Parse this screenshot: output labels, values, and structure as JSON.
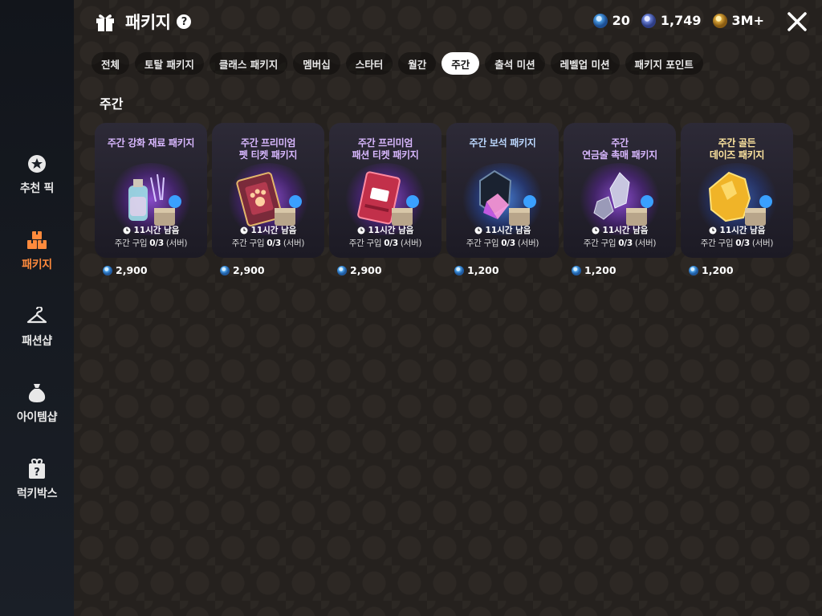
{
  "header": {
    "title": "패키지",
    "help": "?",
    "currencies": [
      {
        "name": "gem-icon",
        "value": "20"
      },
      {
        "name": "diamond-icon",
        "value": "1,749"
      },
      {
        "name": "gold-coin-icon",
        "value": "3M+"
      }
    ]
  },
  "sidebar": {
    "items": [
      {
        "label": "추천 픽",
        "icon": "star-badge-icon"
      },
      {
        "label": "패키지",
        "icon": "boxes-icon"
      },
      {
        "label": "패션샵",
        "icon": "hanger-icon"
      },
      {
        "label": "아이템샵",
        "icon": "money-bag-icon"
      },
      {
        "label": "럭키박스",
        "icon": "mystery-box-icon"
      }
    ],
    "active": "패키지",
    "active_color": "#ff8a3c"
  },
  "tabs": [
    "전체",
    "토탈 패키지",
    "클래스 패키지",
    "멤버십",
    "스타터",
    "월간",
    "주간",
    "출석 미션",
    "레벨업 미션",
    "패키지 포인트"
  ],
  "active_tab": "주간",
  "section_title": "주간",
  "cards": [
    {
      "name_line1": "주간 강화 재료 패키지",
      "name_line2": "",
      "timer": "11시간 남음",
      "limit_prefix": "주간 구입 ",
      "limit_count": "0/3",
      "limit_suffix": " (서버)",
      "price": "2,900",
      "theme": "purple"
    },
    {
      "name_line1": "주간 프리미엄",
      "name_line2": "펫 티켓 패키지",
      "timer": "11시간 남음",
      "limit_prefix": "주간 구입 ",
      "limit_count": "0/3",
      "limit_suffix": " (서버)",
      "price": "2,900",
      "theme": "purple"
    },
    {
      "name_line1": "주간 프리미엄",
      "name_line2": "패션 티켓 패키지",
      "timer": "11시간 남음",
      "limit_prefix": "주간 구입 ",
      "limit_count": "0/3",
      "limit_suffix": " (서버)",
      "price": "2,900",
      "theme": "purple"
    },
    {
      "name_line1": "주간 보석 패키지",
      "name_line2": "",
      "timer": "11시간 남음",
      "limit_prefix": "주간 구입 ",
      "limit_count": "0/3",
      "limit_suffix": " (서버)",
      "price": "1,200",
      "theme": "blue"
    },
    {
      "name_line1": "주간",
      "name_line2": "연금술 촉매 패키지",
      "timer": "11시간 남음",
      "limit_prefix": "주간 구입 ",
      "limit_count": "0/3",
      "limit_suffix": " (서버)",
      "price": "1,200",
      "theme": "purple"
    },
    {
      "name_line1": "주간 골든",
      "name_line2": "데이즈 패키지",
      "timer": "11시간 남음",
      "limit_prefix": "주간 구입 ",
      "limit_count": "0/3",
      "limit_suffix": " (서버)",
      "price": "1,200",
      "theme": "gold"
    }
  ]
}
